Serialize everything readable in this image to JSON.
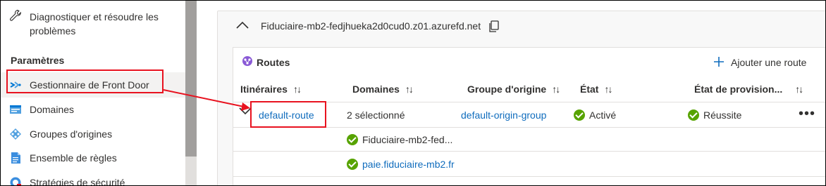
{
  "sidebar": {
    "diagnose_label": "Diagnostiquer et résoudre les problèmes",
    "section_title": "Paramètres",
    "items": [
      {
        "label": "Gestionnaire de Front Door",
        "icon": "front-door-manager-icon"
      },
      {
        "label": "Domaines",
        "icon": "domains-icon"
      },
      {
        "label": "Groupes d'origines",
        "icon": "origin-groups-icon"
      },
      {
        "label": "Ensemble de règles",
        "icon": "rule-set-icon"
      },
      {
        "label": "Stratégies de sécurité",
        "icon": "security-policies-icon"
      }
    ]
  },
  "endpoint": {
    "name": "Fiduciaire-mb2-fedjhueka2d0cud0.z01.azurefd.net"
  },
  "routes": {
    "title": "Routes",
    "add_label": "Ajouter une route",
    "columns": [
      "Itinéraires",
      "Domaines",
      "Groupe d'origine",
      "État",
      "État de provision..."
    ],
    "sort_glyph": "↑↓",
    "row": {
      "route": "default-route",
      "domains": "2 sélectionné",
      "origin_group": "default-origin-group",
      "state": "Activé",
      "provisioning": "Réussite",
      "more": "•••"
    },
    "domains_expanded": [
      "Fiduciaire-mb2-fed...",
      "paie.fiduciaire-mb2.fr"
    ]
  },
  "colors": {
    "link": "#0f6cbd",
    "success": "#57a300",
    "highlight": "#e8121f",
    "selected_bg": "#f3f2f1"
  }
}
